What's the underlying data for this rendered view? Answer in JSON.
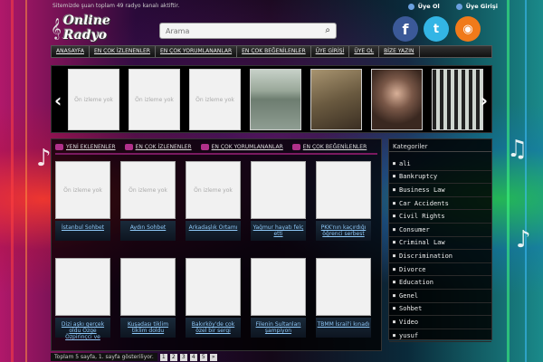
{
  "header": {
    "status": "Sitemizde şuan toplam 49 radyo kanalı aktiftir.",
    "register": "Üye Ol",
    "login": "Üye Girişi",
    "logo_text": "Online Radyo"
  },
  "search": {
    "placeholder": "Arama",
    "value": "Arama"
  },
  "nav": [
    "ANASAYFA",
    "EN ÇOK İZLENENLER",
    "EN ÇOK YORUMLANANLAR",
    "EN ÇOK BEĞENİLENLER",
    "ÜYE GİRİŞİ",
    "ÜYE OL",
    "BİZE YAZIN"
  ],
  "slider": {
    "no_image": "Ön izleme yok"
  },
  "tabs": [
    "YENİ EKLENENLER",
    "EN ÇOK İZLENENLER",
    "EN ÇOK YORUMLANANLAR",
    "EN ÇOK BEĞENİLENLER"
  ],
  "cards": [
    {
      "title": "İstanbul Sohbet"
    },
    {
      "title": "Aydın Sohbet"
    },
    {
      "title": "Arkadaşlık Ortamı"
    },
    {
      "title": "Yağmur hayatı felç etti"
    },
    {
      "title": "PKK'nın kaçırdığı öğrenci serbest"
    },
    {
      "title": "Dizi aşkı gerçek oldu Özge Özpirinçci ve"
    },
    {
      "title": "Kuşadası tiklim tiklim doldu"
    },
    {
      "title": "Bakırköy'de çok özel bir sergi"
    },
    {
      "title": "Filenin Sultanları şampiyon"
    },
    {
      "title": "TBMM İsrail'i kınadı"
    }
  ],
  "pager": {
    "info": "Toplam 5 sayfa, 1. sayfa gösteriliyor.",
    "pages": [
      "1",
      "2",
      "3",
      "4",
      "5",
      "»"
    ]
  },
  "categories": {
    "title": "Kategoriler",
    "items": [
      "ali",
      "Bankruptcy",
      "Business Law",
      "Car Accidents",
      "Civil Rights",
      "Consumer",
      "Criminal Law",
      "Discrimination",
      "Divorce",
      "Education",
      "Genel",
      "Sohbet",
      "Video",
      "yusuf"
    ]
  },
  "icons": [
    "user-icon",
    "facebook-icon",
    "twitter-icon",
    "rss-icon",
    "search-icon",
    "arrow-left-icon",
    "arrow-right-icon",
    "tab-icon",
    "music-note-icon"
  ]
}
